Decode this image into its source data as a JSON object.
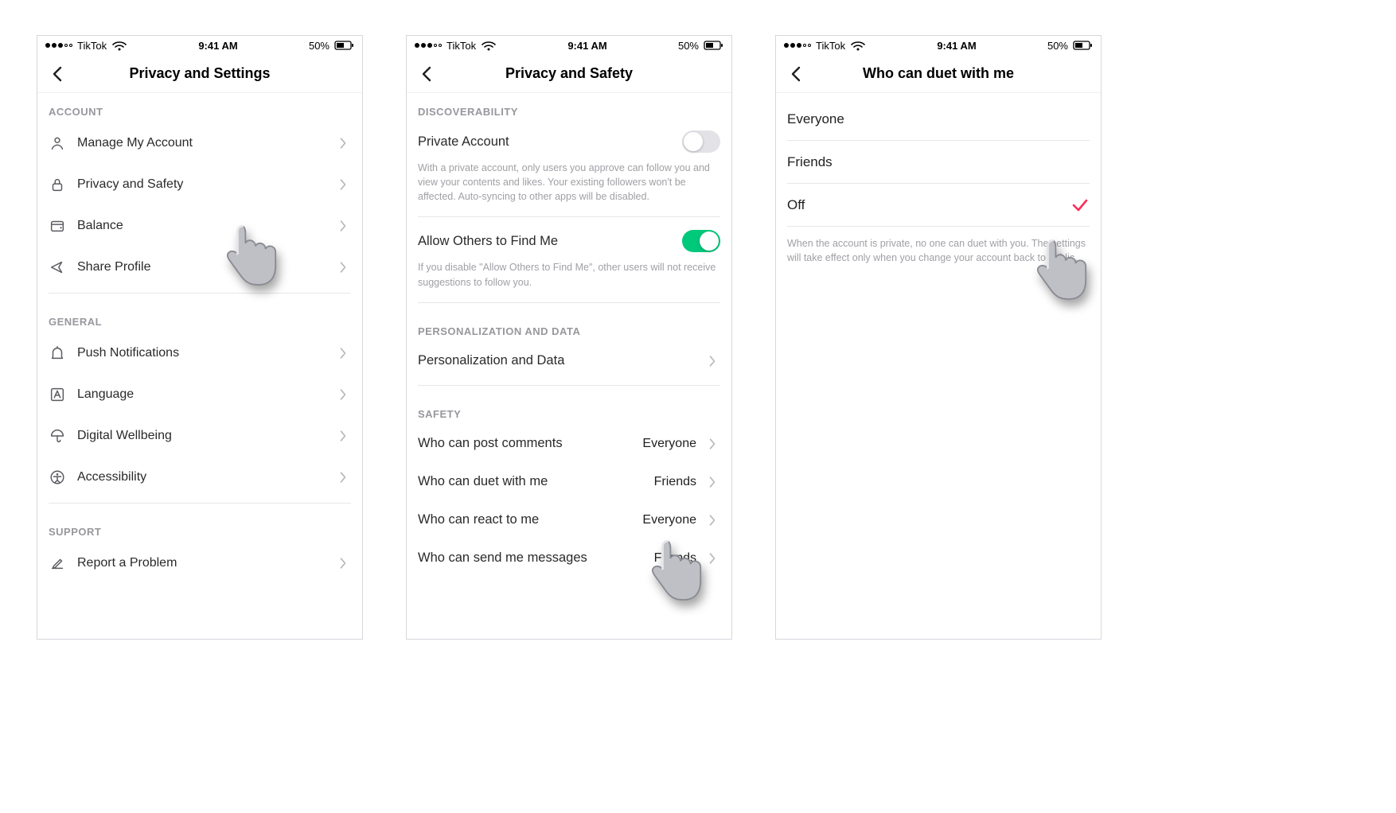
{
  "status_bar": {
    "carrier": "TikTok",
    "time": "9:41 AM",
    "battery_pct": "50%"
  },
  "screen1": {
    "title": "Privacy and Settings",
    "sections": {
      "account": {
        "header": "ACCOUNT",
        "items": [
          {
            "name": "manage-account",
            "label": "Manage My Account",
            "icon": "person-icon"
          },
          {
            "name": "privacy-safety",
            "label": "Privacy and Safety",
            "icon": "lock-icon"
          },
          {
            "name": "balance",
            "label": "Balance",
            "icon": "wallet-icon"
          },
          {
            "name": "share-profile",
            "label": "Share Profile",
            "icon": "share-icon"
          }
        ]
      },
      "general": {
        "header": "GENERAL",
        "items": [
          {
            "name": "push-notifications",
            "label": "Push Notifications",
            "icon": "bell-icon"
          },
          {
            "name": "language",
            "label": "Language",
            "icon": "language-icon"
          },
          {
            "name": "digital-wellbeing",
            "label": "Digital Wellbeing",
            "icon": "umbrella-icon"
          },
          {
            "name": "accessibility",
            "label": "Accessibility",
            "icon": "accessibility-icon"
          }
        ]
      },
      "support": {
        "header": "SUPPORT",
        "items": [
          {
            "name": "report-problem",
            "label": "Report a Problem",
            "icon": "pencil-icon"
          }
        ]
      }
    }
  },
  "screen2": {
    "title": "Privacy and Safety",
    "discoverability_header": "DISCOVERABILITY",
    "private_account": {
      "label": "Private Account",
      "state": "off",
      "desc": "With a private account, only users you approve can follow you and view your contents and likes. Your existing followers won't be affected. Auto-syncing to other apps will be disabled."
    },
    "allow_find_me": {
      "label": "Allow Others to Find Me",
      "state": "on",
      "desc": "If you disable \"Allow Others to Find Me\", other users will not receive suggestions to follow you."
    },
    "personalization_header": "PERSONALIZATION AND DATA",
    "personalization_row": {
      "label": "Personalization and Data"
    },
    "safety_header": "SAFETY",
    "safety_rows": [
      {
        "name": "who-comments",
        "label": "Who can post comments",
        "value": "Everyone"
      },
      {
        "name": "who-duet",
        "label": "Who can duet with me",
        "value": "Friends"
      },
      {
        "name": "who-react",
        "label": "Who can react to me",
        "value": "Everyone"
      },
      {
        "name": "who-messages",
        "label": "Who can send me messages",
        "value": "Friends"
      }
    ]
  },
  "screen3": {
    "title": "Who can duet with me",
    "options": [
      {
        "name": "opt-everyone",
        "label": "Everyone",
        "selected": false
      },
      {
        "name": "opt-friends",
        "label": "Friends",
        "selected": false
      },
      {
        "name": "opt-off",
        "label": "Off",
        "selected": true
      }
    ],
    "footnote": "When the account is private, no one can duet with you. The settings will take effect only when you change your account back to public."
  }
}
